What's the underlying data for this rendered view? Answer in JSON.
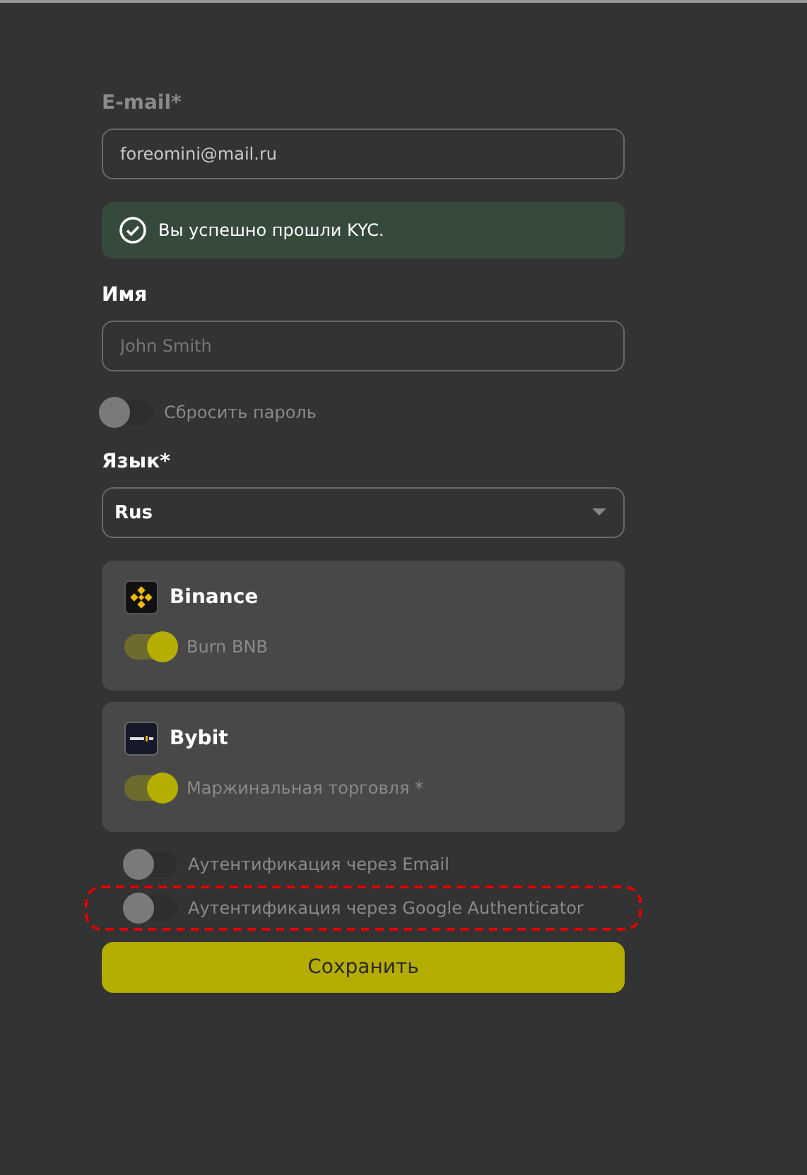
{
  "email": {
    "label": "E-mail*",
    "value": "foreomini@mail.ru"
  },
  "kyc_notice": {
    "text": "Вы успешно прошли KYC."
  },
  "name": {
    "label": "Имя",
    "placeholder": "John Smith"
  },
  "reset_password": {
    "label": "Сбросить пароль",
    "on": false
  },
  "language": {
    "label": "Язык*",
    "value": "Rus"
  },
  "exchanges": [
    {
      "name": "Binance",
      "kind": "binance",
      "option": {
        "label": "Burn BNB",
        "on": true
      }
    },
    {
      "name": "Bybit",
      "kind": "bybit",
      "option": {
        "label": "Маржинальная торговля *",
        "on": true
      }
    }
  ],
  "auth_options": [
    {
      "label": "Аутентификация через Email",
      "on": false,
      "highlighted": false
    },
    {
      "label": "Аутентификация через Google Authenticator",
      "on": false,
      "highlighted": true
    }
  ],
  "save_button": "Сохранить"
}
